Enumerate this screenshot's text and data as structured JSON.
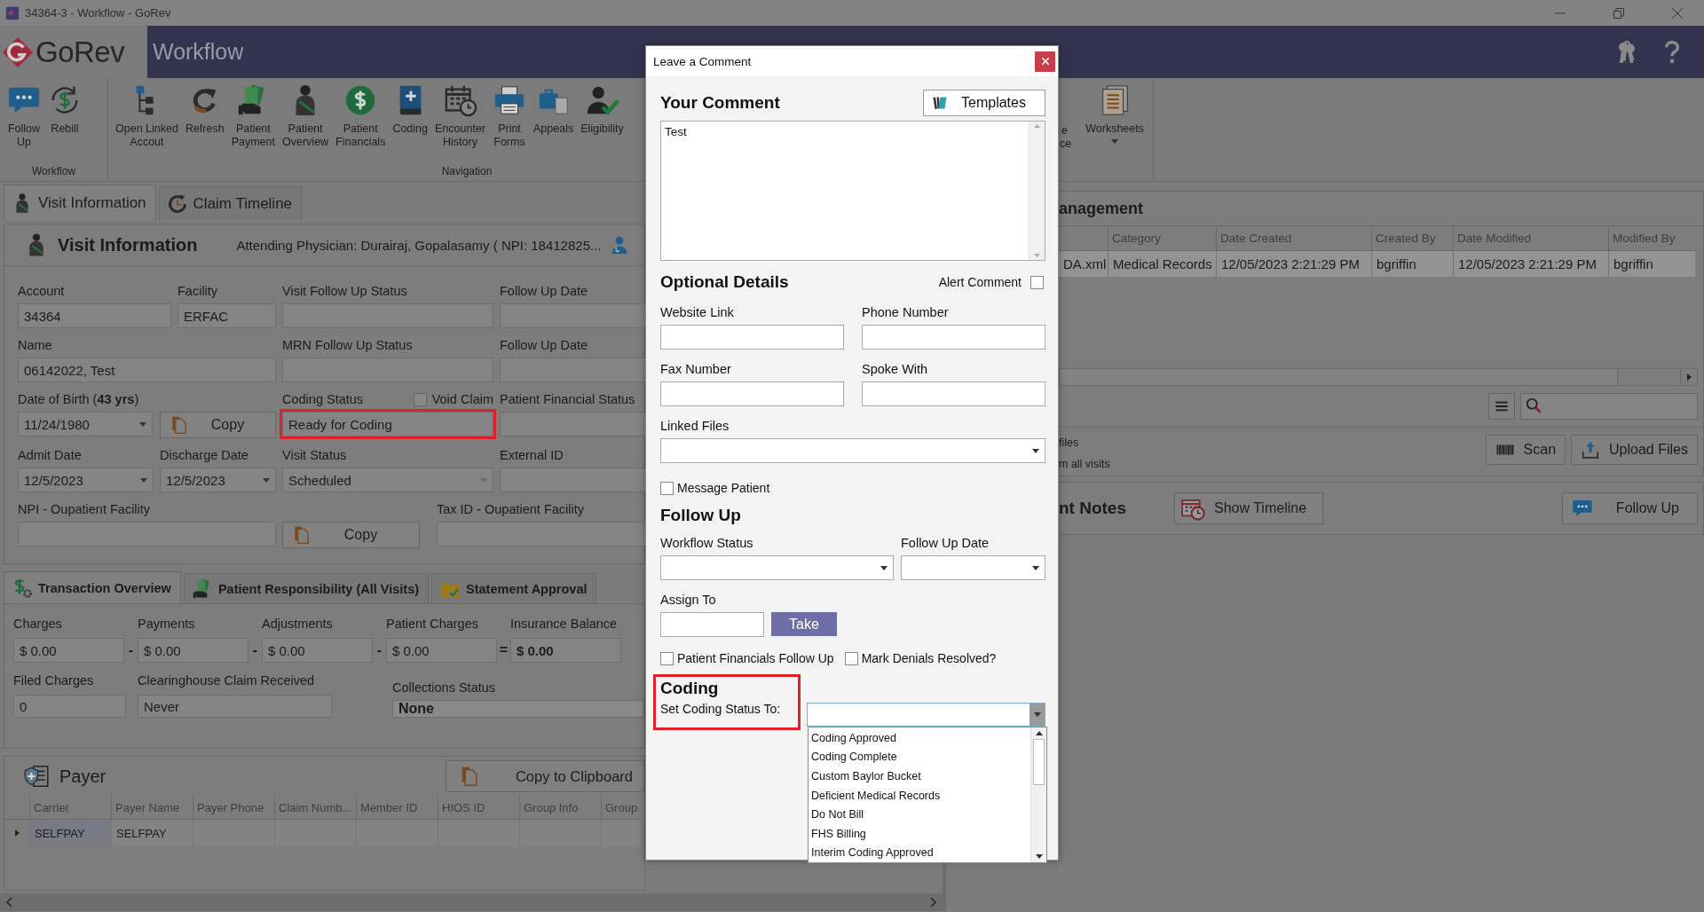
{
  "window": {
    "title": "34364-3 - Workflow - GoRev"
  },
  "header": {
    "logo": "GoRev",
    "title": "Workflow"
  },
  "toolbar": {
    "groups": [
      {
        "label": "Workflow",
        "items": [
          {
            "lines": [
              "Follow",
              "Up"
            ]
          },
          {
            "lines": [
              "Rebill"
            ]
          }
        ]
      },
      {
        "label": "Navigation",
        "items": [
          {
            "lines": [
              "Open Linked",
              "Accout"
            ]
          },
          {
            "lines": [
              "Refresh"
            ]
          },
          {
            "lines": [
              "Patient",
              "Payment"
            ]
          },
          {
            "lines": [
              "Patient",
              "Overview"
            ]
          },
          {
            "lines": [
              "Patient",
              "Financials"
            ]
          },
          {
            "lines": [
              "Coding"
            ]
          },
          {
            "lines": [
              "Encounter",
              "History"
            ]
          },
          {
            "lines": [
              "Print",
              "Forms"
            ]
          },
          {
            "lines": [
              "Appeals"
            ]
          },
          {
            "lines": [
              "Eligibility"
            ]
          }
        ]
      }
    ],
    "partial_item": {
      "lines": [
        "e",
        "ce"
      ]
    },
    "worksheets": {
      "lines": [
        "Worksheets"
      ],
      "dropdown": true
    }
  },
  "visit_tabs": [
    {
      "label": "Visit Information",
      "selected": true
    },
    {
      "label": "Claim Timeline",
      "selected": false
    }
  ],
  "visit_info": {
    "title": "Visit Information",
    "physician": "Attending Physician: Durairaj, Gopalasamy ( NPI: 18412825...",
    "rows": [
      [
        {
          "label": "Account",
          "controls": [
            {
              "kind": "text",
              "value": "34364"
            }
          ]
        },
        {
          "label": "Facility",
          "controls": [
            {
              "kind": "text",
              "value": "ERFAC"
            }
          ]
        },
        {
          "label": "Visit Follow Up Status",
          "controls": [
            {
              "kind": "text"
            }
          ]
        },
        {
          "label": "Follow Up Date",
          "controls": [
            {
              "kind": "text"
            }
          ]
        }
      ],
      [
        {
          "label": "Name",
          "controls": [
            {
              "kind": "text",
              "value": "06142022, Test"
            }
          ]
        },
        {
          "label": "MRN Follow Up Status",
          "controls": [
            {
              "kind": "text"
            }
          ]
        },
        {
          "label": "Follow Up Date",
          "controls": [
            {
              "kind": "text"
            }
          ]
        }
      ],
      [
        {
          "label": "Date of Birth (**43 yrs**)",
          "controls": [
            {
              "kind": "dropdown",
              "value": "11/24/1980"
            },
            {
              "kind": "copy",
              "label": "Copy"
            }
          ]
        },
        {
          "label": "Coding Status",
          "checkbox": {
            "label": "Void Claim",
            "checked": false
          },
          "controls": [
            {
              "kind": "text",
              "value": "Ready for Coding",
              "highlighted": true
            }
          ]
        },
        {
          "label": "Patient Financial Status",
          "controls": [
            {
              "kind": "text"
            }
          ]
        }
      ],
      [
        {
          "label": "Admit Date",
          "controls": [
            {
              "kind": "dropdown",
              "value": "12/5/2023"
            }
          ]
        },
        {
          "label": "Discharge Date",
          "controls": [
            {
              "kind": "dropdown",
              "value": "12/5/2023"
            }
          ]
        },
        {
          "label": "Visit Status",
          "controls": [
            {
              "kind": "dropdown",
              "value": "Scheduled",
              "disabled": true
            }
          ]
        },
        {
          "label": "External ID",
          "controls": [
            {
              "kind": "text"
            }
          ]
        }
      ],
      [
        {
          "label": "NPI - Oupatient Facility",
          "controls": [
            {
              "kind": "text"
            }
          ]
        },
        {
          "controls": [
            {
              "kind": "copy",
              "label": "Copy"
            }
          ]
        },
        {
          "label": "Tax ID - Oupatient Facility",
          "controls": [
            {
              "kind": "text"
            }
          ]
        }
      ]
    ]
  },
  "transaction_tabs": [
    {
      "label": "Transaction Overview",
      "selected": true
    },
    {
      "label": "Patient Responsibility (All Visits)",
      "selected": false
    },
    {
      "label": "Statement Approval",
      "selected": false
    }
  ],
  "transactions": {
    "amounts": [
      {
        "label": "Charges",
        "value": "$ 0.00",
        "bold": false
      },
      {
        "label": "Payments",
        "value": "$ 0.00",
        "operator": "-",
        "bold": false
      },
      {
        "label": "Adjustments",
        "value": "$ 0.00",
        "operator": "-",
        "bold": false
      },
      {
        "label": "Patient Charges",
        "value": "$ 0.00",
        "operator": "-",
        "bold": false
      },
      {
        "label": "Insurance Balance",
        "value": "$ 0.00",
        "operator": "=",
        "bold": true
      }
    ],
    "details": [
      {
        "label": "Filed Charges",
        "value": "0",
        "kind": "text"
      },
      {
        "label": "Clearinghouse Claim Received",
        "value": "Never",
        "kind": "text"
      },
      {
        "label": "Collections Status",
        "value": "None",
        "kind": "dropdown"
      }
    ]
  },
  "payer": {
    "title": "Payer",
    "copy_button": "Copy to Clipboard",
    "columns": [
      "Carrier",
      "Payer Name",
      "Payer Phone",
      "Claim Numb...",
      "Member ID",
      "HIOS ID",
      "Group Info",
      "Group"
    ],
    "rows": [
      {
        "cells": [
          "SELFPAY",
          "SELFPAY"
        ],
        "expanded": false
      }
    ]
  },
  "documents": {
    "title": "anagement",
    "columns": [
      "",
      "Category",
      "Date Created",
      "Created By",
      "Date Modified",
      "Modified By"
    ],
    "rows": [
      {
        "cells": [
          "DA.xml",
          "Medical Records",
          "12/05/2023 2:21:29 PM",
          "bgriffin",
          "12/05/2023 2:21:29 PM",
          "bgriffin"
        ],
        "selected": true
      }
    ],
    "options": [
      "files",
      "m all visits"
    ],
    "buttons": [
      {
        "label": "Scan"
      },
      {
        "label": "Upload Files"
      }
    ]
  },
  "notes": {
    "title": "nt Notes",
    "timeline_button": "Show Timeline",
    "follow_up_button": "Follow Up"
  },
  "dialog": {
    "title": "Leave a Comment",
    "comment_heading": "Your Comment",
    "templates_button": "Templates",
    "comment": "Test",
    "optional_heading": "Optional Details",
    "alert_comment": {
      "label": "Alert Comment",
      "checked": false
    },
    "fields": [
      {
        "label": "Website Link"
      },
      {
        "label": "Phone Number"
      },
      {
        "label": "Fax Number"
      },
      {
        "label": "Spoke With"
      }
    ],
    "linked_files": {
      "label": "Linked Files"
    },
    "message_patient": {
      "label": "Message Patient",
      "checked": false
    },
    "follow_up_heading": "Follow Up",
    "workflow_status": {
      "label": "Workflow Status"
    },
    "follow_up_date": {
      "label": "Follow Up Date"
    },
    "assign_to": {
      "label": "Assign To"
    },
    "take_button": "Take",
    "checks": [
      {
        "label": "Patient Financials Follow Up",
        "checked": false
      },
      {
        "label": "Mark Denials Resolved?",
        "checked": false
      }
    ],
    "coding": {
      "heading": "Coding",
      "label": "Set Coding Status To:",
      "highlighted": true,
      "open": true,
      "options": [
        "Coding Approved",
        "Coding Complete",
        "Custom Baylor Bucket",
        "Deficient Medical Records",
        "Do Not Bill",
        "FHS Billing",
        "Interim Coding Approved"
      ]
    }
  }
}
